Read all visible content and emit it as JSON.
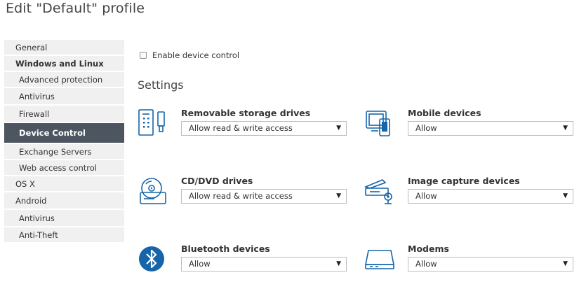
{
  "page": {
    "title": "Edit \"Default\" profile"
  },
  "sidebar": {
    "items": [
      {
        "label": "General"
      },
      {
        "label": "Windows and Linux"
      },
      {
        "label": "Advanced protection"
      },
      {
        "label": "Antivirus"
      },
      {
        "label": "Firewall"
      },
      {
        "label": "Device Control"
      },
      {
        "label": "Exchange Servers"
      },
      {
        "label": "Web access control"
      },
      {
        "label": "OS X"
      },
      {
        "label": "Android"
      },
      {
        "label": "Antivirus"
      },
      {
        "label": "Anti-Theft"
      }
    ],
    "active_item": "Device Control"
  },
  "main": {
    "enable_label": "Enable device control",
    "enable_checked": false,
    "settings_title": "Settings",
    "devices": [
      {
        "label": "Removable storage drives",
        "value": "Allow read & write access",
        "icon": "usb-drive-icon"
      },
      {
        "label": "Mobile devices",
        "value": "Allow",
        "icon": "mobile-devices-icon"
      },
      {
        "label": "CD/DVD drives",
        "value": "Allow read & write access",
        "icon": "cd-dvd-icon"
      },
      {
        "label": "Image capture devices",
        "value": "Allow",
        "icon": "scanner-camera-icon"
      },
      {
        "label": "Bluetooth devices",
        "value": "Allow",
        "icon": "bluetooth-icon"
      },
      {
        "label": "Modems",
        "value": "Allow",
        "icon": "modem-icon"
      }
    ]
  },
  "colors": {
    "accent_blue": "#1565a8",
    "active_bg": "#4d5660",
    "sidebar_bg": "#f0f0f0"
  }
}
